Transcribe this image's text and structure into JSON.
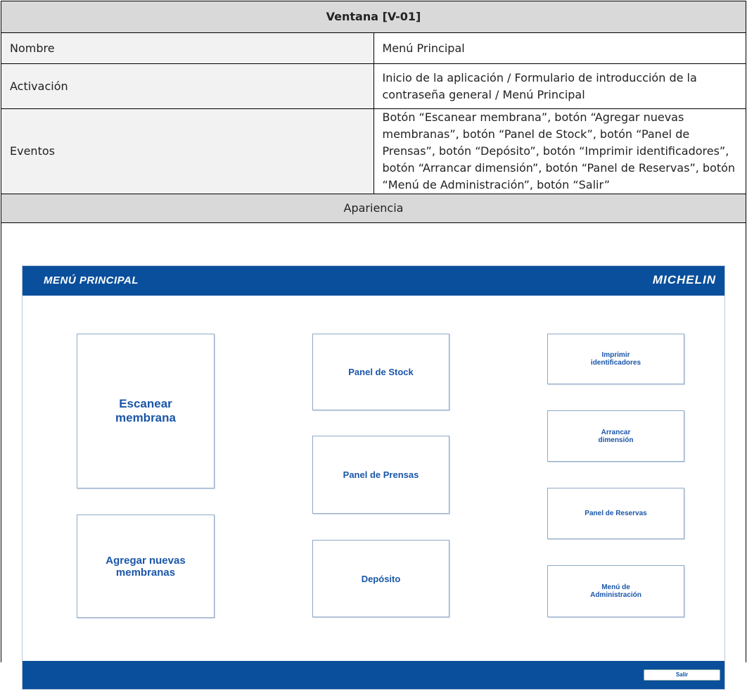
{
  "spec": {
    "header": "Ventana [V-01]",
    "rows": [
      {
        "label": "Nombre",
        "value": "Menú Principal"
      },
      {
        "label": "Activación",
        "value": "Inicio de la aplicación / Formulario de introducción de la contraseña general / Menú Principal"
      },
      {
        "label": "Eventos",
        "value": "Botón “Escanear membrana”, botón “Agregar nuevas membranas”, botón “Panel de Stock”, botón “Panel de Prensas”, botón “Depósito”, botón “Imprimir identificadores”, botón “Arrancar dimensión”, botón “Panel de Reservas”, botón “Menú de Administración”, botón “Salir”"
      }
    ],
    "appearance_label": "Apariencia"
  },
  "mockup": {
    "title": "MENÚ PRINCIPAL",
    "brand": "MICHELIN",
    "buttons": {
      "scan": "Escanear membrana",
      "add": "Agregar nuevas membranas",
      "stock": "Panel de Stock",
      "presses": "Panel de Prensas",
      "deposit": "Depósito",
      "print": "Imprimir identificadores",
      "start": "Arrancar dimensión",
      "reserves": "Panel de Reservas",
      "admin": "Menú de Administración"
    },
    "exit": "Salir",
    "colors": {
      "bar": "#0a4f9c",
      "button_text": "#1a56a8"
    }
  }
}
